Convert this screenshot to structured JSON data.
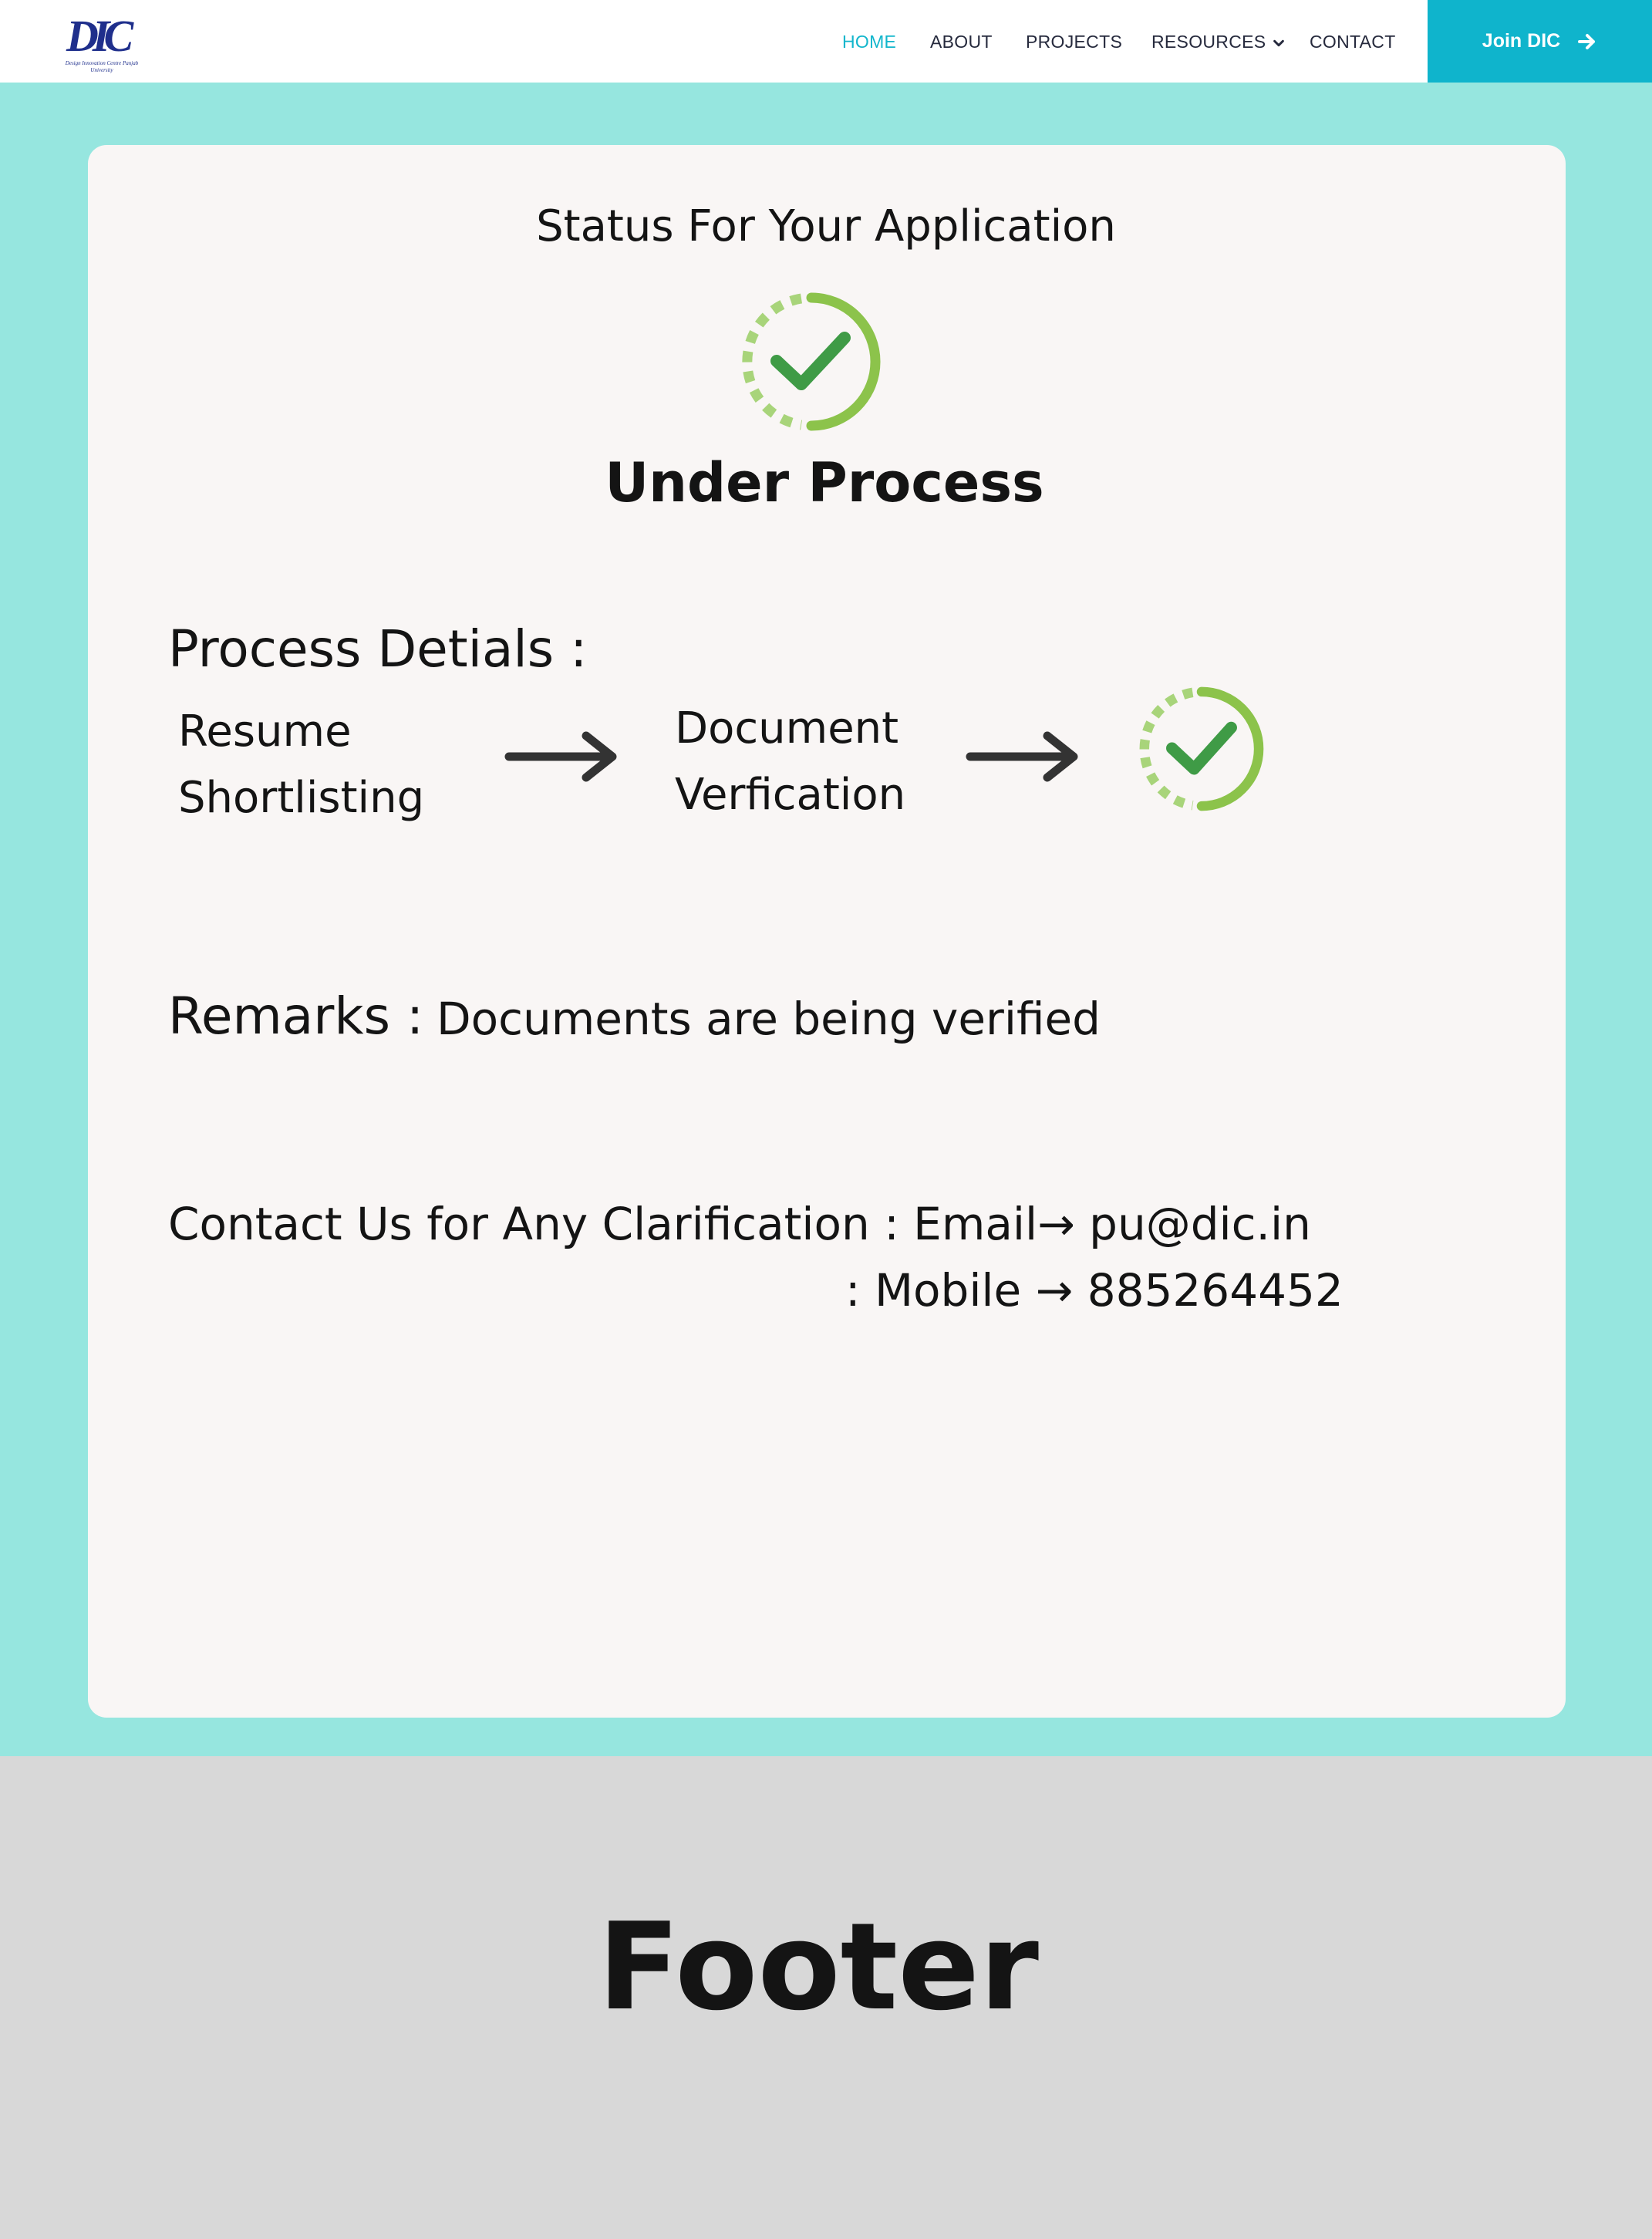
{
  "header": {
    "logo": {
      "mark": "DIC",
      "tagline": "Design Innovation Centre Panjab University"
    },
    "nav": [
      {
        "label": "HOME",
        "active": true
      },
      {
        "label": "ABOUT",
        "active": false
      },
      {
        "label": "PROJECTS",
        "active": false
      },
      {
        "label": "RESOURCES",
        "active": false,
        "has_dropdown": true
      },
      {
        "label": "CONTACT",
        "active": false
      }
    ],
    "cta_label": "Join DIC",
    "cta_icon": "arrow-right-icon"
  },
  "status": {
    "title": "Status For Your Application",
    "value": "Under Process",
    "icon": "check-circle-progress-icon"
  },
  "process": {
    "label": "Process Detials :",
    "steps": [
      {
        "line1": "Resume",
        "line2": "Shortlisting"
      },
      {
        "line1": "Document",
        "line2": "Verfication"
      }
    ],
    "final_icon": "check-circle-progress-icon",
    "arrow_icon": "long-arrow-right-icon"
  },
  "remarks": {
    "label": "Remarks :",
    "value": "Documents are being verified"
  },
  "contact": {
    "line1": "Contact Us for Any Clarification : Email→ pu@dic.in",
    "line2": ":  Mobile → 885264452"
  },
  "footer": {
    "title": "Footer"
  },
  "colors": {
    "background": "#96e6df",
    "accent": "#0fb4cc",
    "nav_active": "#12b6cc",
    "card": "#f9f6f5",
    "check_green": "#3f9b46",
    "ring_green": "#8cc34b",
    "footer": "#d8d8d8"
  }
}
